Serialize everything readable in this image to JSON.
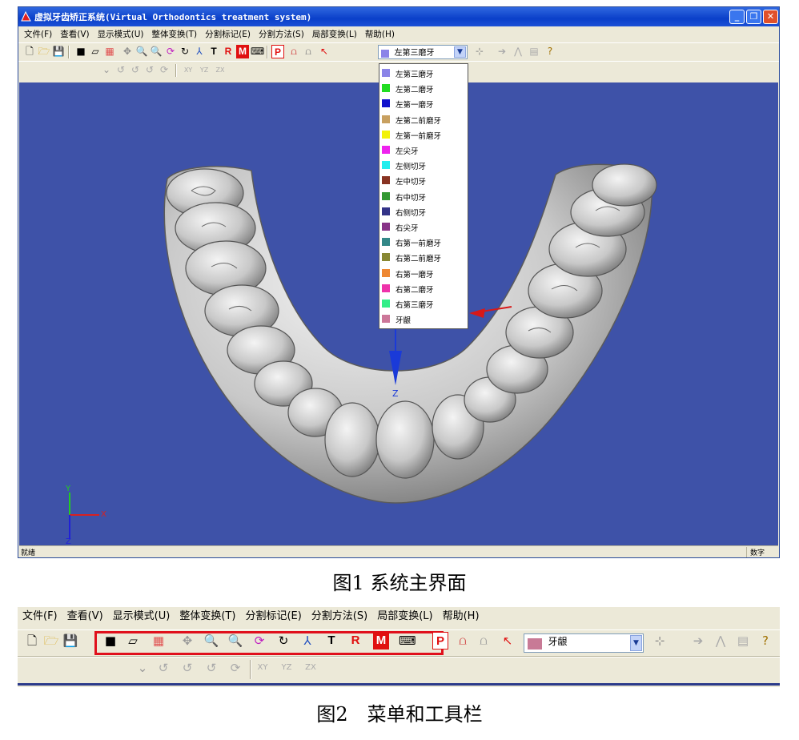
{
  "window": {
    "title": "虚拟牙齿矫正系统(Virtual Orthodontics treatment system)",
    "controls": {
      "minimize": "_",
      "maximize": "❐",
      "close": "✕"
    }
  },
  "menu": [
    "文件(F)",
    "查看(V)",
    "显示模式(U)",
    "整体变换(T)",
    "分割标记(E)",
    "分割方法(S)",
    "局部变换(L)",
    "帮助(H)"
  ],
  "toolbar": {
    "letters": {
      "t": "T",
      "r": "R",
      "m": "M",
      "p": "P"
    },
    "tooth_combo_value": "左第三磨牙",
    "tooth_combo_color": "#8b84e8",
    "gum_combo_value": "牙龈",
    "gum_combo_color": "#c87a96"
  },
  "transform_toolbar": {
    "axis_pairs": [
      "XY",
      "YZ",
      "ZX"
    ]
  },
  "tooth_list": [
    {
      "label": "左第三磨牙",
      "color": "#8b84e8"
    },
    {
      "label": "左第二磨牙",
      "color": "#22dd22"
    },
    {
      "label": "左第一磨牙",
      "color": "#1111cc"
    },
    {
      "label": "左第二前磨牙",
      "color": "#c8a060"
    },
    {
      "label": "左第一前磨牙",
      "color": "#f2f20a"
    },
    {
      "label": "左尖牙",
      "color": "#ee22ee"
    },
    {
      "label": "左侧切牙",
      "color": "#22eeee"
    },
    {
      "label": "左中切牙",
      "color": "#883322"
    },
    {
      "label": "右中切牙",
      "color": "#339933"
    },
    {
      "label": "右侧切牙",
      "color": "#333388"
    },
    {
      "label": "右尖牙",
      "color": "#883388"
    },
    {
      "label": "右第一前磨牙",
      "color": "#338888"
    },
    {
      "label": "右第二前磨牙",
      "color": "#888833"
    },
    {
      "label": "右第一磨牙",
      "color": "#ee8833"
    },
    {
      "label": "右第二磨牙",
      "color": "#ee33aa"
    },
    {
      "label": "右第三磨牙",
      "color": "#33ee88"
    },
    {
      "label": "牙龈",
      "color": "#cc7799"
    }
  ],
  "viewport": {
    "background": "#3e52a8",
    "axes": {
      "x": "X",
      "y": "Y",
      "z": "Z"
    }
  },
  "status": {
    "left": "就绪",
    "right": "数字"
  },
  "captions": {
    "fig1": "图1 系统主界面",
    "fig2": "图2　菜单和工具栏"
  }
}
